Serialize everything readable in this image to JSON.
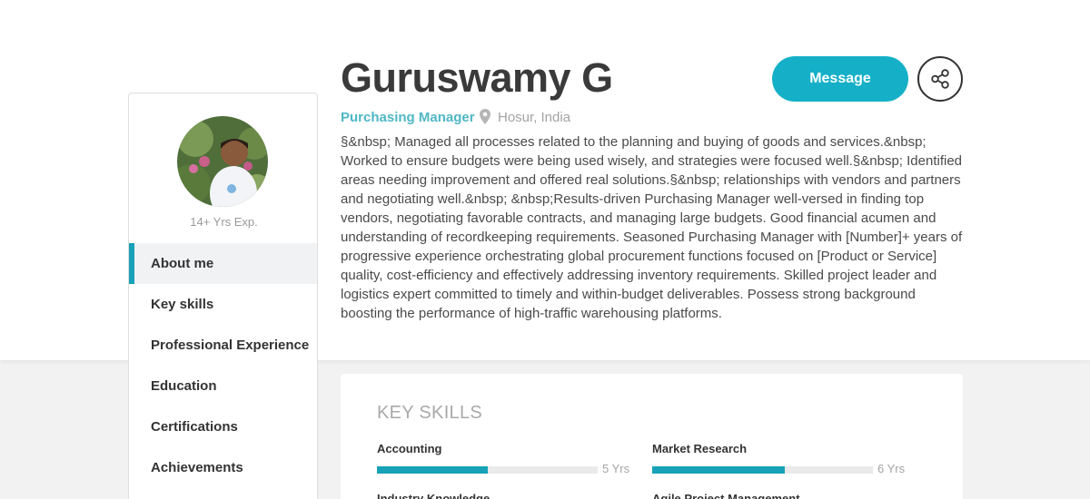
{
  "profile": {
    "name": "Guruswamy G",
    "role": "Purchasing Manager",
    "location": "Hosur, India",
    "experience": "14+ Yrs Exp.",
    "about": "§&nbsp; Managed all processes related to the planning and buying of goods and services.&nbsp; Worked to ensure budgets were being used wisely, and strategies were focused well.§&nbsp; Identified areas needing improvement and offered real solutions.§&nbsp; relationships with vendors and partners and negotiating well.&nbsp; &nbsp;Results-driven Purchasing Manager well-versed in finding top vendors, negotiating favorable contracts, and managing large budgets. Good financial acumen and understanding of recordkeeping requirements. Seasoned Purchasing Manager with [Number]+ years of progressive experience orchestrating global procurement functions focused on [Product or Service] quality, cost-efficiency and effectively addressing inventory requirements. Skilled project leader and logistics expert committed to timely and within-budget deliverables. Possess strong background boosting the performance of high-traffic warehousing platforms."
  },
  "actions": {
    "message_label": "Message",
    "share_icon": "share-icon"
  },
  "sidebar": {
    "items": [
      {
        "label": "About me",
        "active": true
      },
      {
        "label": "Key skills",
        "active": false
      },
      {
        "label": "Professional Experience",
        "active": false
      },
      {
        "label": "Education",
        "active": false
      },
      {
        "label": "Certifications",
        "active": false
      },
      {
        "label": "Achievements",
        "active": false
      }
    ]
  },
  "skills": {
    "title": "KEY SKILLS",
    "items": [
      {
        "name": "Accounting",
        "years": "5 Yrs",
        "level": 0.5
      },
      {
        "name": "Market Research",
        "years": "6 Yrs",
        "level": 0.6
      },
      {
        "name": "Industry Knowledge",
        "years": "",
        "level": 0
      },
      {
        "name": "Agile Project Management",
        "years": "",
        "level": 0
      }
    ]
  },
  "colors": {
    "accent": "#15b0c8",
    "role_text": "#4fb7c5"
  }
}
